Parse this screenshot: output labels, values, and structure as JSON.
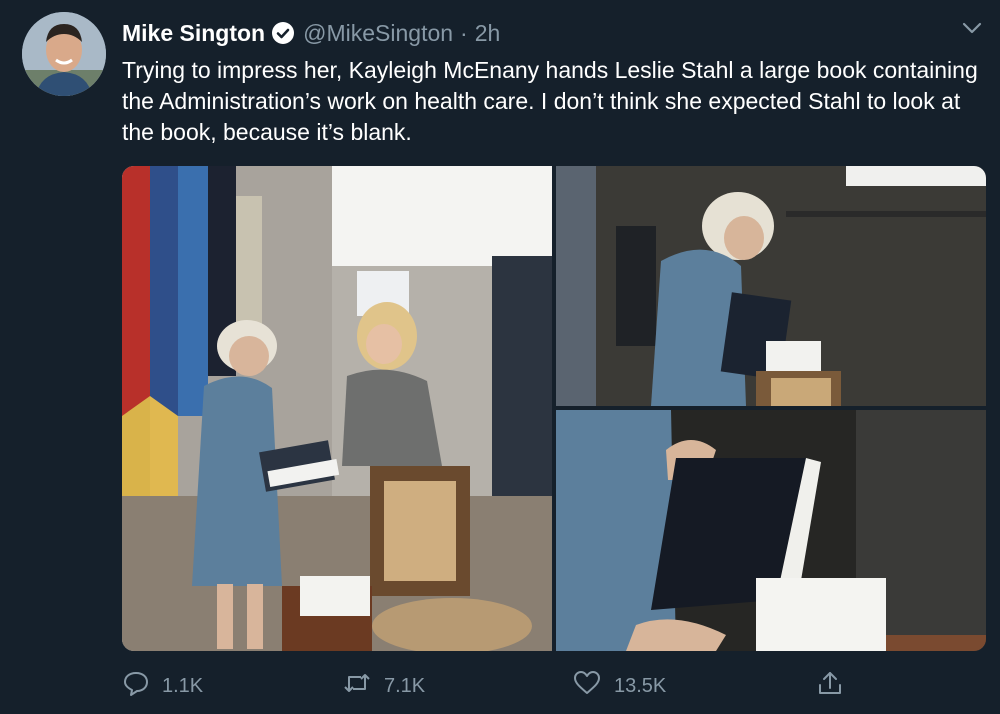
{
  "tweet": {
    "author_name": "Mike Sington",
    "handle": "@MikeSington",
    "separator": "·",
    "time": "2h",
    "text": "Trying to impress her, Kayleigh McEnany hands Leslie Stahl a large book containing the Administration’s work on health care. I don’t think she expected Stahl to look at the book, because it’s blank."
  },
  "actions": {
    "replies": "1.1K",
    "retweets": "7.1K",
    "likes": "13.5K"
  },
  "icons": {
    "verified": "verified-badge-icon",
    "more": "chevron-down-icon",
    "reply": "reply-icon",
    "retweet": "retweet-icon",
    "like": "heart-icon",
    "share": "share-icon"
  },
  "colors": {
    "background": "#15202b",
    "text": "#ffffff",
    "secondary": "#8899a6"
  }
}
